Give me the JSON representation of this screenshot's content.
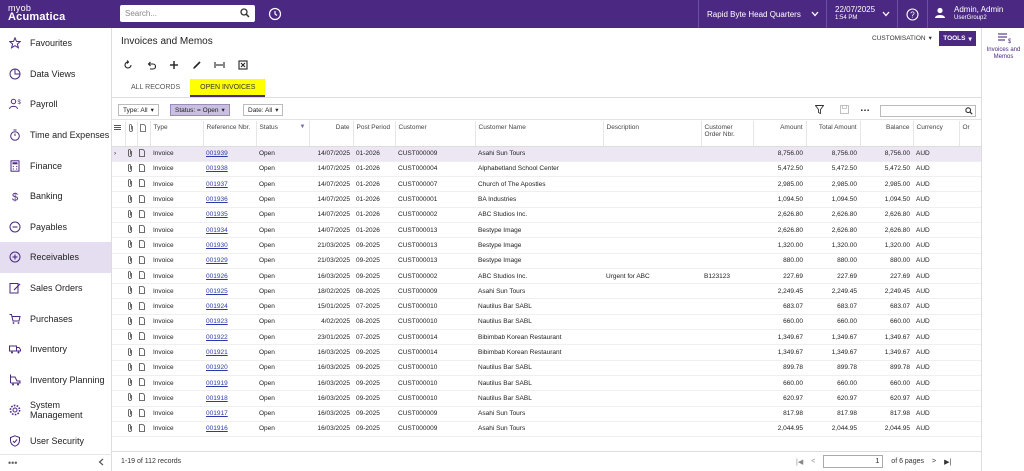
{
  "brand": {
    "line1": "myob",
    "line2": "Acumatica"
  },
  "search": {
    "placeholder": "Search..."
  },
  "company": "Rapid Byte Head Quarters",
  "datetime": {
    "date": "22/07/2025",
    "time": "1:54 PM"
  },
  "user": {
    "name": "Admin, Admin",
    "group": "UserGroup2"
  },
  "sidebar": {
    "items": [
      {
        "label": "Favourites",
        "icon": "star-icon"
      },
      {
        "label": "Data Views",
        "icon": "pie-chart-icon"
      },
      {
        "label": "Payroll",
        "icon": "person-dollar-icon"
      },
      {
        "label": "Time and Expenses",
        "icon": "stopwatch-icon"
      },
      {
        "label": "Finance",
        "icon": "calculator-icon"
      },
      {
        "label": "Banking",
        "icon": "dollar-icon"
      },
      {
        "label": "Payables",
        "icon": "minus-circle-icon"
      },
      {
        "label": "Receivables",
        "icon": "plus-circle-icon",
        "active": true
      },
      {
        "label": "Sales Orders",
        "icon": "edit-document-icon"
      },
      {
        "label": "Purchases",
        "icon": "cart-icon"
      },
      {
        "label": "Inventory",
        "icon": "truck-icon"
      },
      {
        "label": "Inventory Planning",
        "icon": "forklift-icon"
      },
      {
        "label": "System Management",
        "icon": "gear-icon"
      },
      {
        "label": "User Security",
        "icon": "shield-icon"
      }
    ]
  },
  "page": {
    "title": "Invoices and Memos",
    "customisation": "CUSTOMISATION",
    "tools": "TOOLS"
  },
  "tabs": [
    {
      "label": "ALL RECORDS",
      "active": false
    },
    {
      "label": "OPEN INVOICES",
      "active": true
    }
  ],
  "filters": {
    "type": "Type: All",
    "status": "Status: = Open",
    "date": "Date: All"
  },
  "columns": {
    "type": "Type",
    "ref": "Reference Nbr.",
    "status": "Status",
    "date": "Date",
    "period": "Post Period",
    "customer": "Customer",
    "customer_name": "Customer Name",
    "description": "Description",
    "order_nbr": "Customer Order Nbr.",
    "amount": "Amount",
    "total": "Total Amount",
    "balance": "Balance",
    "currency": "Currency",
    "extra": "Or"
  },
  "rows": [
    {
      "type": "Invoice",
      "ref": "001939",
      "status": "Open",
      "date": "14/07/2025",
      "period": "01-2026",
      "customer": "CUST000009",
      "name": "Asahi Sun Tours",
      "desc": "",
      "order": "",
      "amount": "8,756.00",
      "total": "8,756.00",
      "balance": "8,756.00",
      "cur": "AUD"
    },
    {
      "type": "Invoice",
      "ref": "001938",
      "status": "Open",
      "date": "14/07/2025",
      "period": "01-2026",
      "customer": "CUST000004",
      "name": "Alphabetland School Center",
      "desc": "",
      "order": "",
      "amount": "5,472.50",
      "total": "5,472.50",
      "balance": "5,472.50",
      "cur": "AUD"
    },
    {
      "type": "Invoice",
      "ref": "001937",
      "status": "Open",
      "date": "14/07/2025",
      "period": "01-2026",
      "customer": "CUST000007",
      "name": "Church of The Apostles",
      "desc": "",
      "order": "",
      "amount": "2,985.00",
      "total": "2,985.00",
      "balance": "2,985.00",
      "cur": "AUD"
    },
    {
      "type": "Invoice",
      "ref": "001936",
      "status": "Open",
      "date": "14/07/2025",
      "period": "01-2026",
      "customer": "CUST000001",
      "name": "BA Industries",
      "desc": "",
      "order": "",
      "amount": "1,094.50",
      "total": "1,094.50",
      "balance": "1,094.50",
      "cur": "AUD"
    },
    {
      "type": "Invoice",
      "ref": "001935",
      "status": "Open",
      "date": "14/07/2025",
      "period": "01-2026",
      "customer": "CUST000002",
      "name": "ABC Studios Inc.",
      "desc": "",
      "order": "",
      "amount": "2,626.80",
      "total": "2,626.80",
      "balance": "2,626.80",
      "cur": "AUD"
    },
    {
      "type": "Invoice",
      "ref": "001934",
      "status": "Open",
      "date": "14/07/2025",
      "period": "01-2026",
      "customer": "CUST000013",
      "name": "Bestype Image",
      "desc": "",
      "order": "",
      "amount": "2,626.80",
      "total": "2,626.80",
      "balance": "2,626.80",
      "cur": "AUD"
    },
    {
      "type": "Invoice",
      "ref": "001930",
      "status": "Open",
      "date": "21/03/2025",
      "period": "09-2025",
      "customer": "CUST000013",
      "name": "Bestype Image",
      "desc": "",
      "order": "",
      "amount": "1,320.00",
      "total": "1,320.00",
      "balance": "1,320.00",
      "cur": "AUD"
    },
    {
      "type": "Invoice",
      "ref": "001929",
      "status": "Open",
      "date": "21/03/2025",
      "period": "09-2025",
      "customer": "CUST000013",
      "name": "Bestype Image",
      "desc": "",
      "order": "",
      "amount": "880.00",
      "total": "880.00",
      "balance": "880.00",
      "cur": "AUD"
    },
    {
      "type": "Invoice",
      "ref": "001926",
      "status": "Open",
      "date": "16/03/2025",
      "period": "09-2025",
      "customer": "CUST000002",
      "name": "ABC Studios Inc.",
      "desc": "Urgent for ABC",
      "order": "B123123",
      "amount": "227.69",
      "total": "227.69",
      "balance": "227.69",
      "cur": "AUD"
    },
    {
      "type": "Invoice",
      "ref": "001925",
      "status": "Open",
      "date": "18/02/2025",
      "period": "08-2025",
      "customer": "CUST000009",
      "name": "Asahi Sun Tours",
      "desc": "",
      "order": "",
      "amount": "2,249.45",
      "total": "2,249.45",
      "balance": "2,249.45",
      "cur": "AUD"
    },
    {
      "type": "Invoice",
      "ref": "001924",
      "status": "Open",
      "date": "15/01/2025",
      "period": "07-2025",
      "customer": "CUST000010",
      "name": "Nautilus Bar SABL",
      "desc": "",
      "order": "",
      "amount": "683.07",
      "total": "683.07",
      "balance": "683.07",
      "cur": "AUD"
    },
    {
      "type": "Invoice",
      "ref": "001923",
      "status": "Open",
      "date": "4/02/2025",
      "period": "08-2025",
      "customer": "CUST000010",
      "name": "Nautilus Bar SABL",
      "desc": "",
      "order": "",
      "amount": "660.00",
      "total": "660.00",
      "balance": "660.00",
      "cur": "AUD"
    },
    {
      "type": "Invoice",
      "ref": "001922",
      "status": "Open",
      "date": "23/01/2025",
      "period": "07-2025",
      "customer": "CUST000014",
      "name": "Bibimbab Korean Restaurant",
      "desc": "",
      "order": "",
      "amount": "1,349.67",
      "total": "1,349.67",
      "balance": "1,349.67",
      "cur": "AUD"
    },
    {
      "type": "Invoice",
      "ref": "001921",
      "status": "Open",
      "date": "16/03/2025",
      "period": "09-2025",
      "customer": "CUST000014",
      "name": "Bibimbab Korean Restaurant",
      "desc": "",
      "order": "",
      "amount": "1,349.67",
      "total": "1,349.67",
      "balance": "1,349.67",
      "cur": "AUD"
    },
    {
      "type": "Invoice",
      "ref": "001920",
      "status": "Open",
      "date": "16/03/2025",
      "period": "09-2025",
      "customer": "CUST000010",
      "name": "Nautilus Bar SABL",
      "desc": "",
      "order": "",
      "amount": "899.78",
      "total": "899.78",
      "balance": "899.78",
      "cur": "AUD"
    },
    {
      "type": "Invoice",
      "ref": "001919",
      "status": "Open",
      "date": "16/03/2025",
      "period": "09-2025",
      "customer": "CUST000010",
      "name": "Nautilus Bar SABL",
      "desc": "",
      "order": "",
      "amount": "660.00",
      "total": "660.00",
      "balance": "660.00",
      "cur": "AUD"
    },
    {
      "type": "Invoice",
      "ref": "001918",
      "status": "Open",
      "date": "16/03/2025",
      "period": "09-2025",
      "customer": "CUST000010",
      "name": "Nautilus Bar SABL",
      "desc": "",
      "order": "",
      "amount": "620.97",
      "total": "620.97",
      "balance": "620.97",
      "cur": "AUD"
    },
    {
      "type": "Invoice",
      "ref": "001917",
      "status": "Open",
      "date": "16/03/2025",
      "period": "09-2025",
      "customer": "CUST000009",
      "name": "Asahi Sun Tours",
      "desc": "",
      "order": "",
      "amount": "817.98",
      "total": "817.98",
      "balance": "817.98",
      "cur": "AUD"
    },
    {
      "type": "Invoice",
      "ref": "001916",
      "status": "Open",
      "date": "16/03/2025",
      "period": "09-2025",
      "customer": "CUST000009",
      "name": "Asahi Sun Tours",
      "desc": "",
      "order": "",
      "amount": "2,044.95",
      "total": "2,044.95",
      "balance": "2,044.95",
      "cur": "AUD"
    }
  ],
  "footer": {
    "records": "1-19 of 112 records",
    "page": "1",
    "pages": "of 6 pages"
  },
  "rightpanel": {
    "label": "Invoices and Memos"
  },
  "colors": {
    "brand": "#4b2982",
    "tab_highlight": "#ffff00",
    "link": "#2b3aa8"
  }
}
